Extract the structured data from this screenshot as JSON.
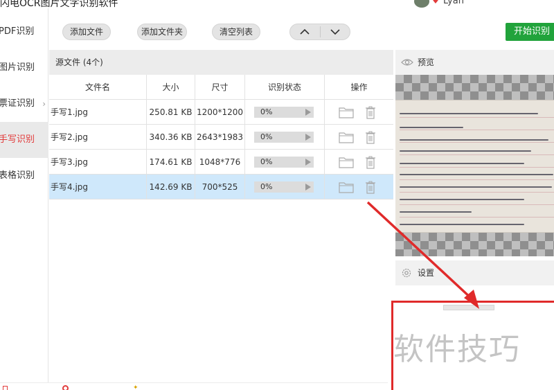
{
  "window": {
    "title": "闪电OCR图片文字识别软件",
    "user": "Lyan"
  },
  "sidebar": {
    "items": [
      {
        "label": "PDF识别"
      },
      {
        "label": "图片识别"
      },
      {
        "label": "票证识别"
      },
      {
        "label": "手写识别",
        "active": true
      },
      {
        "label": "表格识别"
      }
    ]
  },
  "toolbar": {
    "add_file": "添加文件",
    "add_folder": "添加文件夹",
    "clear_list": "清空列表",
    "start": "开始识别"
  },
  "files": {
    "header": "源文件 (4个)",
    "columns": [
      "文件名",
      "大小",
      "尺寸",
      "识别状态",
      "操作"
    ],
    "rows": [
      {
        "name": "手写1.jpg",
        "size": "250.81 KB",
        "dim": "1200*1200",
        "progress": "0%"
      },
      {
        "name": "手写2.jpg",
        "size": "340.36 KB",
        "dim": "2643*1983",
        "progress": "0%"
      },
      {
        "name": "手写3.jpg",
        "size": "174.61 KB",
        "dim": "1048*776",
        "progress": "0%"
      },
      {
        "name": "手写4.jpg",
        "size": "142.69 KB",
        "dim": "700*525",
        "progress": "0%",
        "selected": true
      }
    ]
  },
  "preview": {
    "label": "预览"
  },
  "settings": {
    "label": "设置"
  },
  "watermark": "软件技巧",
  "colors": {
    "accent_red": "#e02a2a",
    "start_green": "#21a33b",
    "selected_row": "#cfe8fb"
  }
}
